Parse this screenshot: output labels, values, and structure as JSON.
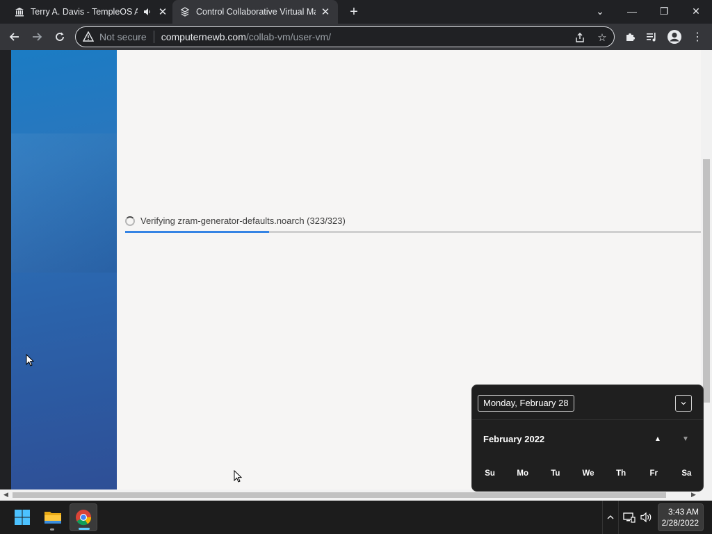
{
  "browser": {
    "tabs": [
      {
        "title": "Terry A. Davis - TempleOS Ar",
        "favicon": "building-columns-icon",
        "audio": true
      },
      {
        "title": "Control Collaborative Virtual Ma",
        "favicon": "vm-logo-icon"
      }
    ],
    "new_tab": "+",
    "window_controls": {
      "dropdown": "⌄",
      "minimize": "—",
      "restore": "❐",
      "close": "✕"
    },
    "toolbar": {
      "security_label": "Not secure",
      "url_host": "computernewb.com",
      "url_path": "/collab-vm/user-vm/"
    }
  },
  "vm": {
    "status_text": "Verifying zram-generator-defaults.noarch (323/323)",
    "progress": 0.25
  },
  "calendar": {
    "selected_date": "Monday, February 28",
    "month_label": "February 2022",
    "weekdays": [
      "Su",
      "Mo",
      "Tu",
      "We",
      "Th",
      "Fr",
      "Sa"
    ]
  },
  "taskbar": {
    "time": "3:43 AM",
    "date": "2/28/2022",
    "apps": [
      "start-icon",
      "file-explorer-icon",
      "chrome-icon"
    ]
  },
  "colors": {
    "accent": "#3584e4",
    "sidebar": "#2a6db5",
    "vm_background": "#f6f5f4"
  }
}
